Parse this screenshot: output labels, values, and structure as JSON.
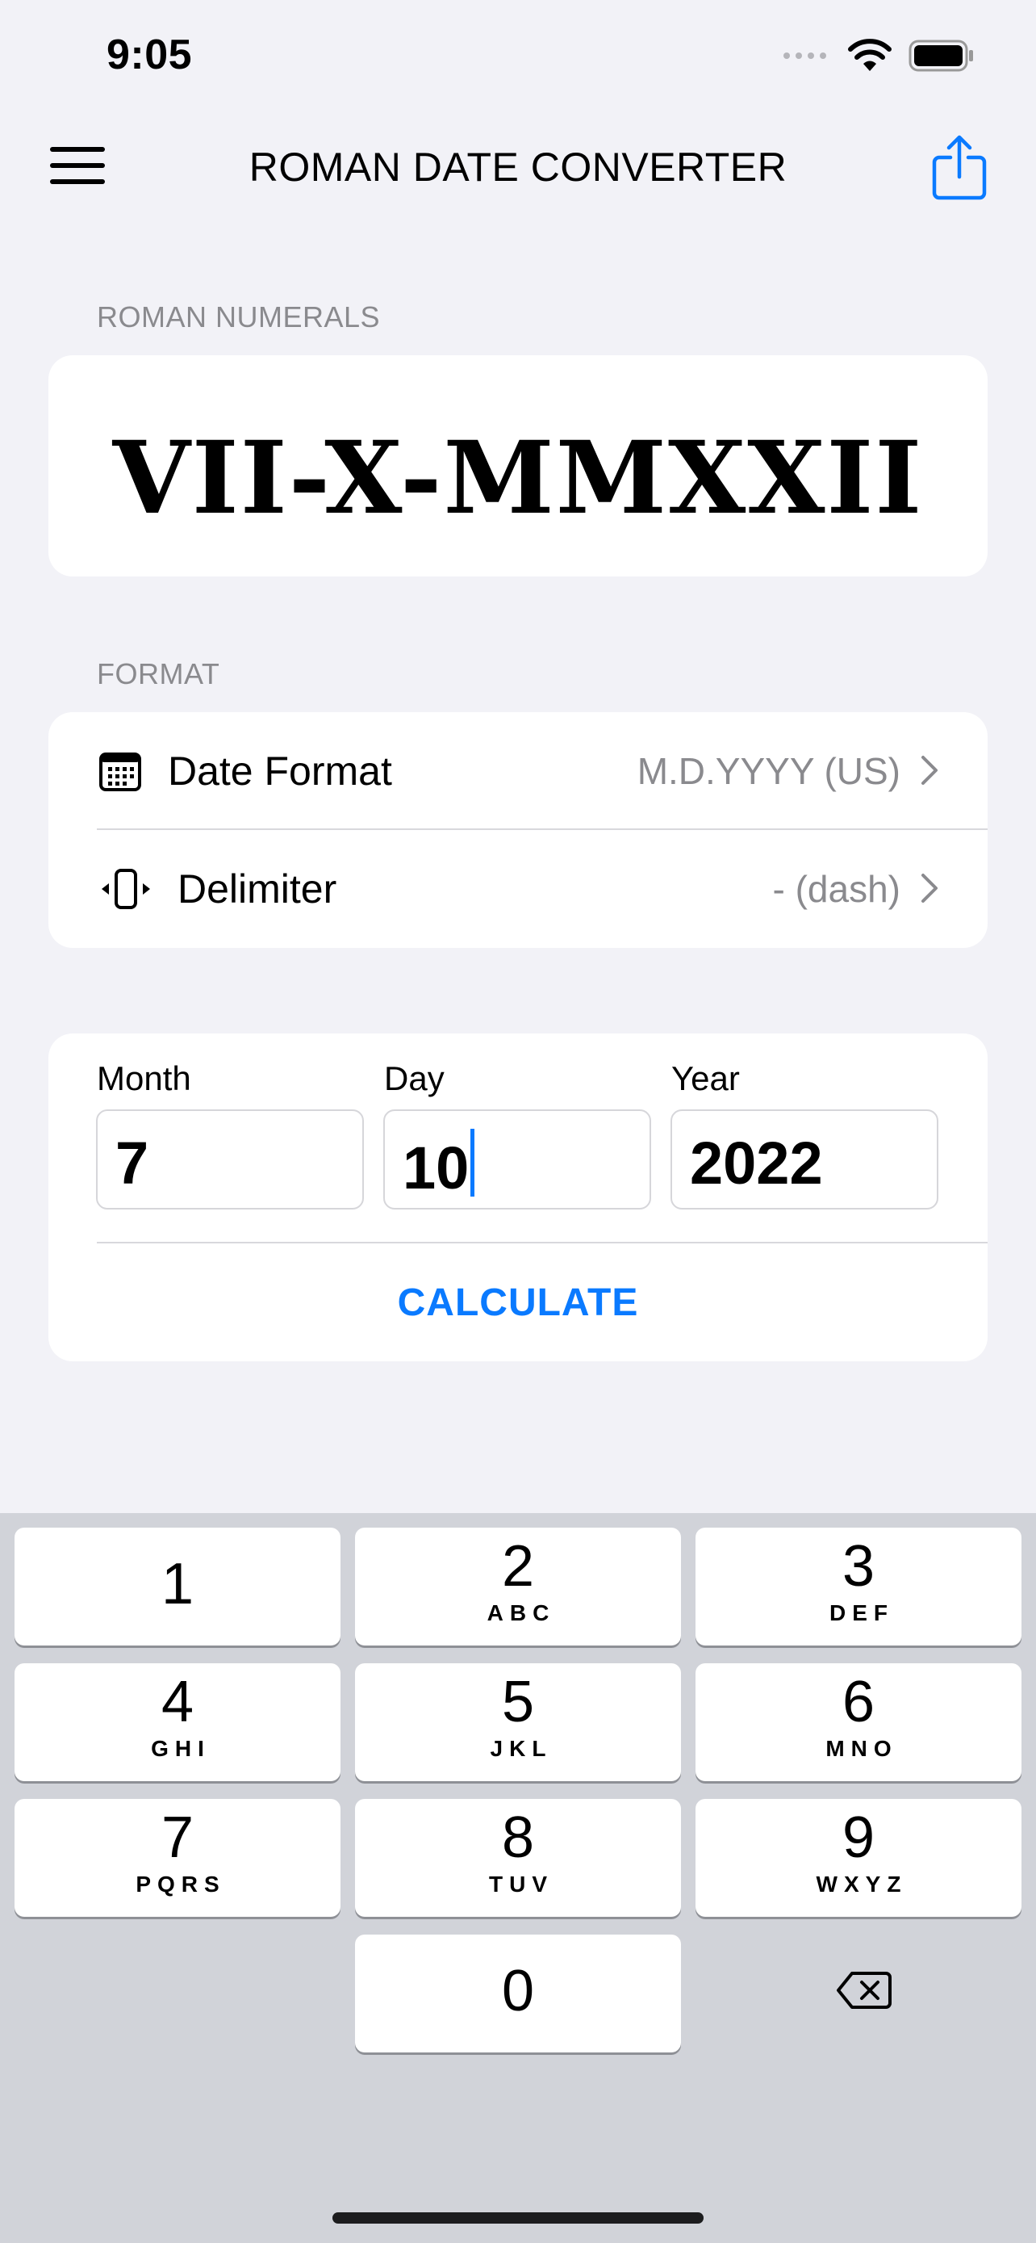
{
  "status_bar": {
    "time": "9:05"
  },
  "nav": {
    "title": "ROMAN DATE CONVERTER",
    "menu_icon": "hamburger-menu-icon",
    "share_icon": "share-icon"
  },
  "roman_section": {
    "label": "ROMAN NUMERALS",
    "result": "VII-X-MMXXII"
  },
  "format_section": {
    "label": "FORMAT",
    "rows": [
      {
        "icon": "calendar-icon",
        "label": "Date Format",
        "value": "M.D.YYYY (US)"
      },
      {
        "icon": "delimiter-icon",
        "label": "Delimiter",
        "value": "- (dash)"
      }
    ]
  },
  "input_section": {
    "fields": [
      {
        "label": "Month",
        "value": "7"
      },
      {
        "label": "Day",
        "value": "10"
      },
      {
        "label": "Year",
        "value": "2022"
      }
    ],
    "calculate_label": "CALCULATE"
  },
  "keyboard": {
    "keys": [
      {
        "num": "1",
        "letters": ""
      },
      {
        "num": "2",
        "letters": "ABC"
      },
      {
        "num": "3",
        "letters": "DEF"
      },
      {
        "num": "4",
        "letters": "GHI"
      },
      {
        "num": "5",
        "letters": "JKL"
      },
      {
        "num": "6",
        "letters": "MNO"
      },
      {
        "num": "7",
        "letters": "PQRS"
      },
      {
        "num": "8",
        "letters": "TUV"
      },
      {
        "num": "9",
        "letters": "WXYZ"
      },
      {
        "num": "0",
        "letters": ""
      }
    ],
    "backspace_icon": "backspace-icon"
  },
  "colors": {
    "accent": "#0a7aff",
    "background": "#f2f2f7",
    "secondary_text": "#8a8a8e"
  }
}
